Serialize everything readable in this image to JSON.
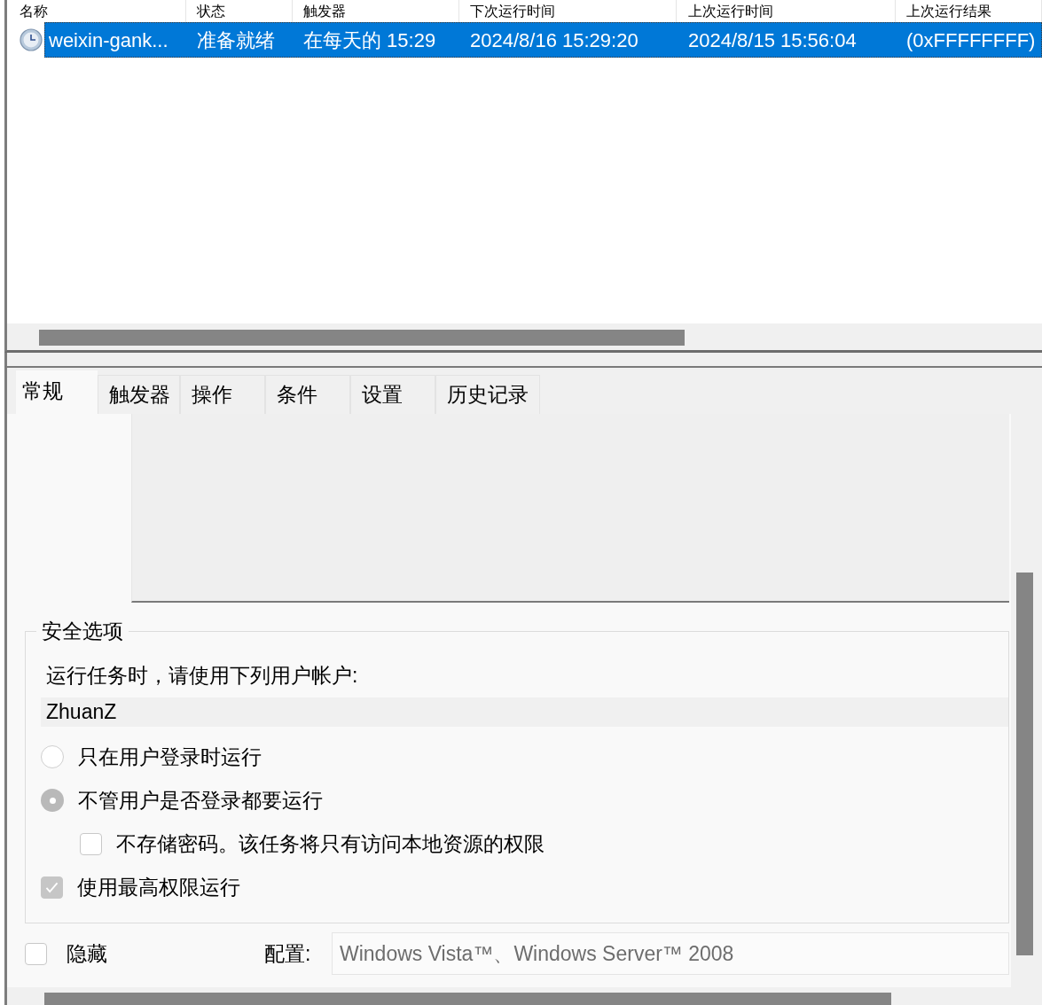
{
  "task_list": {
    "columns": [
      "名称",
      "状态",
      "触发器",
      "下次运行时间",
      "上次运行时间",
      "上次运行结果"
    ],
    "rows": [
      {
        "selected": true,
        "cells": [
          "weixin-gank...",
          "准备就绪",
          "在每天的 15:29",
          "2024/8/16 15:29:20",
          "2024/8/15 15:56:04",
          "(0xFFFFFFFF)"
        ]
      }
    ]
  },
  "tabs": [
    {
      "label": "常规",
      "selected": true
    },
    {
      "label": "触发器",
      "selected": false
    },
    {
      "label": "操作",
      "selected": false
    },
    {
      "label": "条件",
      "selected": false
    },
    {
      "label": "设置",
      "selected": false
    },
    {
      "label": "历史记录",
      "selected": false
    }
  ],
  "general": {
    "security_options": {
      "title": "安全选项",
      "account_prompt": "运行任务时，请使用下列用户帐户:",
      "account": "ZhuanZ",
      "options": [
        {
          "kind": "radio",
          "label": "只在用户登录时运行",
          "selected": false,
          "disabled": true
        },
        {
          "kind": "radio",
          "label": "不管用户是否登录都要运行",
          "selected": true,
          "disabled": true,
          "children": [
            {
              "kind": "checkbox",
              "label": "不存储密码。该任务将只有访问本地资源的权限",
              "checked": false,
              "disabled": true
            }
          ]
        },
        {
          "kind": "checkbox",
          "label": "使用最高权限运行",
          "checked": true,
          "disabled": true
        }
      ]
    },
    "hidden": {
      "label": "隐藏",
      "checked": false,
      "disabled": true
    },
    "configure_for": {
      "label": "配置:",
      "value": "Windows Vista™、Windows Server™ 2008",
      "disabled": true
    }
  }
}
